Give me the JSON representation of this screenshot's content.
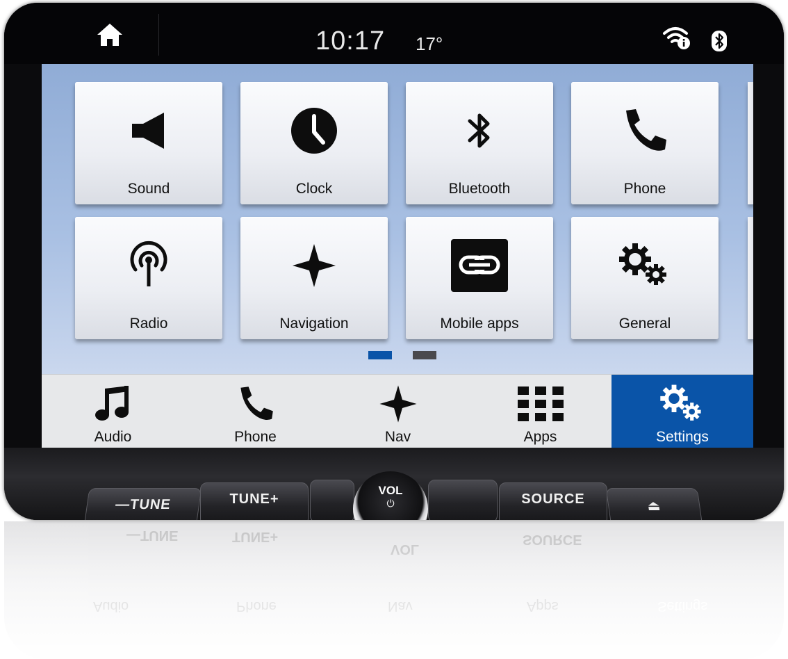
{
  "status_bar": {
    "time": "10:17",
    "temperature": "17°",
    "icons": [
      "home-icon",
      "wifi-info-icon",
      "bluetooth-icon"
    ]
  },
  "settings_grid": {
    "tiles": [
      {
        "label": "Sound",
        "icon": "speaker-icon"
      },
      {
        "label": "Clock",
        "icon": "clock-icon"
      },
      {
        "label": "Bluetooth",
        "icon": "bluetooth-icon"
      },
      {
        "label": "Phone",
        "icon": "phone-icon"
      },
      {
        "label": "Radio",
        "icon": "radio-antenna-icon"
      },
      {
        "label": "Navigation",
        "icon": "compass-star-icon"
      },
      {
        "label": "Mobile apps",
        "icon": "link-icon"
      },
      {
        "label": "General",
        "icon": "gears-icon"
      }
    ],
    "pages": {
      "count": 2,
      "current": 1
    },
    "colors": {
      "active_dot": "#0a54a8",
      "inactive_dot": "#4a4a4e"
    }
  },
  "nav_bar": {
    "items": [
      {
        "label": "Audio",
        "icon": "music-note-icon",
        "active": false
      },
      {
        "label": "Phone",
        "icon": "phone-icon",
        "active": false
      },
      {
        "label": "Nav",
        "icon": "compass-star-icon",
        "active": false
      },
      {
        "label": "Apps",
        "icon": "apps-grid-icon",
        "active": false
      },
      {
        "label": "Settings",
        "icon": "gears-icon",
        "active": true
      }
    ],
    "active_color": "#0a54a8"
  },
  "console": {
    "tune_down": "—TUNE",
    "tune_up": "TUNE+",
    "vol": "VOL",
    "power_symbol": "⏻",
    "source": "SOURCE",
    "eject_symbol": "⏏"
  }
}
